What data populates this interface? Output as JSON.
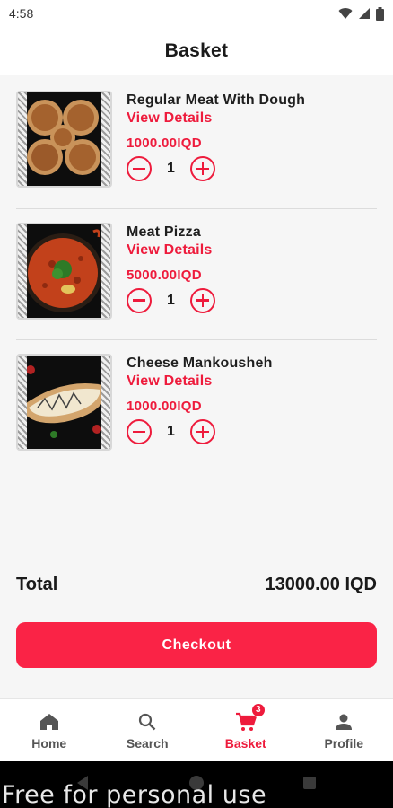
{
  "status_bar": {
    "time": "4:58"
  },
  "app_bar": {
    "title": "Basket"
  },
  "items": [
    {
      "name": "Regular Meat With Dough",
      "details_label": "View Details",
      "price": "1000.00IQD",
      "quantity": "1"
    },
    {
      "name": "Meat Pizza",
      "details_label": "View Details",
      "price": "5000.00IQD",
      "quantity": "1"
    },
    {
      "name": "Cheese Mankousheh",
      "details_label": "View Details",
      "price": "1000.00IQD",
      "quantity": "1"
    }
  ],
  "summary": {
    "total_label": "Total",
    "total_value": "13000.00 IQD"
  },
  "checkout": {
    "label": "Checkout"
  },
  "bottom_nav": {
    "items": [
      {
        "label": "Home",
        "icon": "home-icon"
      },
      {
        "label": "Search",
        "icon": "search-icon"
      },
      {
        "label": "Basket",
        "icon": "cart-icon",
        "badge": "3",
        "active": true
      },
      {
        "label": "Profile",
        "icon": "person-icon"
      }
    ]
  },
  "watermark": "Free for personal use",
  "colors": {
    "accent": "#ee1b3c",
    "button": "#fa2346",
    "background": "#f6f6f6"
  }
}
